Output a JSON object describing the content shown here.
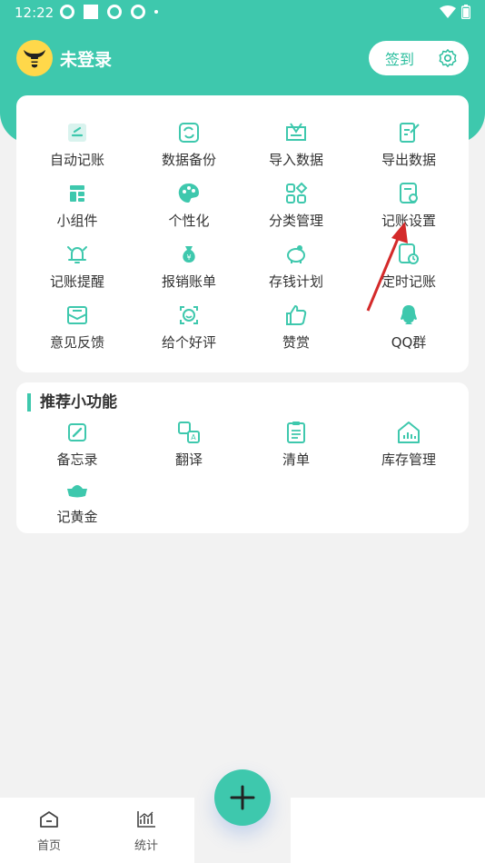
{
  "status": {
    "time": "12:22"
  },
  "user": {
    "name": "未登录"
  },
  "header": {
    "signin": "签到"
  },
  "features": [
    {
      "label": "自动记账",
      "icon": "auto-bookkeeping-icon"
    },
    {
      "label": "数据备份",
      "icon": "backup-icon"
    },
    {
      "label": "导入数据",
      "icon": "import-icon"
    },
    {
      "label": "导出数据",
      "icon": "export-icon"
    },
    {
      "label": "小组件",
      "icon": "widget-icon"
    },
    {
      "label": "个性化",
      "icon": "palette-icon"
    },
    {
      "label": "分类管理",
      "icon": "category-icon"
    },
    {
      "label": "记账设置",
      "icon": "settings-doc-icon"
    },
    {
      "label": "记账提醒",
      "icon": "bell-icon"
    },
    {
      "label": "报销账单",
      "icon": "money-bag-icon"
    },
    {
      "label": "存钱计划",
      "icon": "piggy-bank-icon"
    },
    {
      "label": "定时记账",
      "icon": "clock-doc-icon"
    },
    {
      "label": "意见反馈",
      "icon": "feedback-icon"
    },
    {
      "label": "给个好评",
      "icon": "rate-icon"
    },
    {
      "label": "赞赏",
      "icon": "thumbs-up-icon"
    },
    {
      "label": "QQ群",
      "icon": "qq-icon"
    }
  ],
  "recommend": {
    "title": "推荐小功能",
    "items": [
      {
        "label": "备忘录",
        "icon": "memo-icon"
      },
      {
        "label": "翻译",
        "icon": "translate-icon"
      },
      {
        "label": "清单",
        "icon": "checklist-icon"
      },
      {
        "label": "库存管理",
        "icon": "warehouse-icon"
      },
      {
        "label": "记黄金",
        "icon": "gold-icon"
      }
    ]
  },
  "nav": {
    "home": "首页",
    "stats": "统计"
  },
  "colors": {
    "accent": "#3ec8ad",
    "annotation": "#d42a2a"
  }
}
